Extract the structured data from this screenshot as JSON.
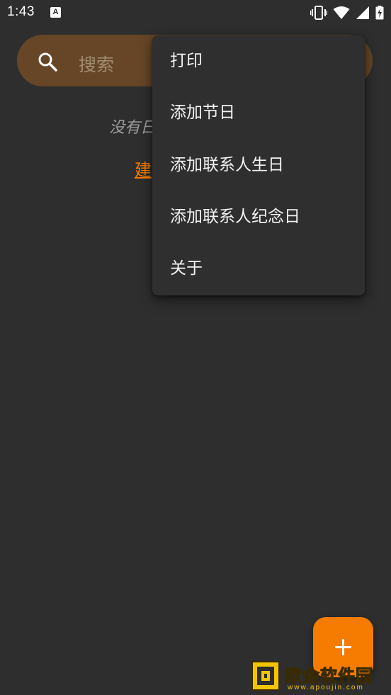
{
  "status_bar": {
    "time": "1:43",
    "notification_icon": "a-icon",
    "icons": [
      "vibrate-icon",
      "wifi-icon",
      "signal-icon",
      "battery-charging-icon"
    ]
  },
  "search": {
    "placeholder": "搜索",
    "icon": "search-icon"
  },
  "empty_state": {
    "message": "没有日",
    "create_link": "建"
  },
  "menu": {
    "items": [
      {
        "label": "打印"
      },
      {
        "label": "添加节日"
      },
      {
        "label": "添加联系人生日"
      },
      {
        "label": "添加联系人纪念日"
      },
      {
        "label": "关于"
      }
    ]
  },
  "fab": {
    "icon": "plus-icon"
  },
  "watermark": {
    "text": "欧金软件园",
    "url": "www.apoujin.com"
  },
  "colors": {
    "background": "#2e2e2e",
    "accent": "#f57c00",
    "search_bg": "#664626",
    "menu_bg": "#2f2f2f"
  }
}
